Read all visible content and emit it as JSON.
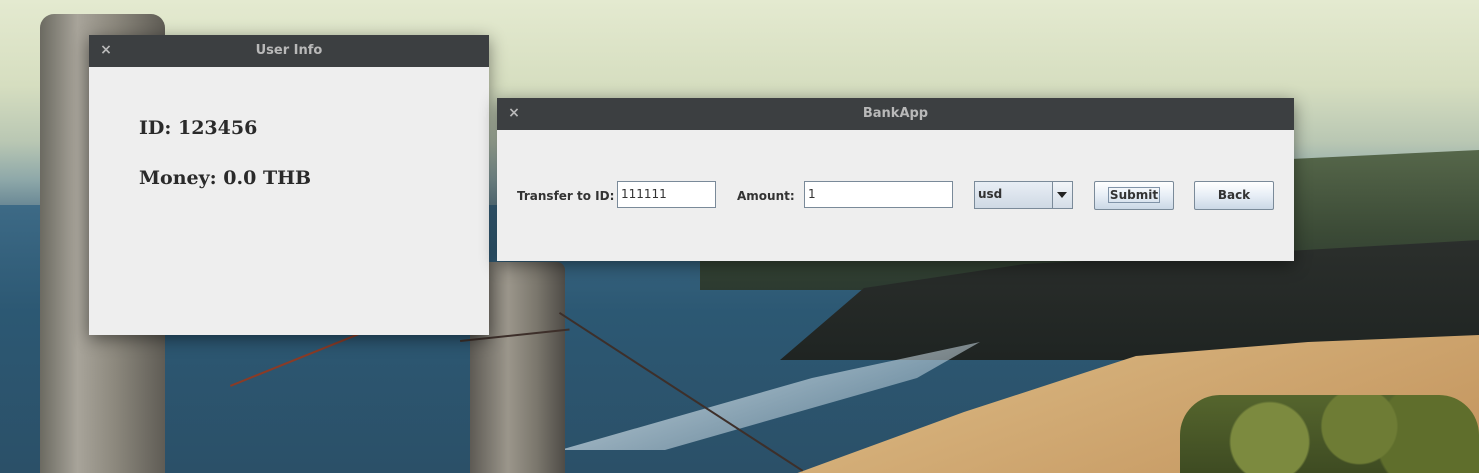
{
  "user_info_window": {
    "title": "User Info",
    "close_glyph": "×",
    "id_line": "ID: 123456",
    "money_line": "Money: 0.0 THB"
  },
  "bankapp_window": {
    "title": "BankApp",
    "close_glyph": "×",
    "transfer_label": "Transfer to ID:",
    "transfer_value": "111111",
    "amount_label": "Amount:",
    "amount_value": "1",
    "currency_selected": "usd",
    "submit_label": "Submit",
    "back_label": "Back"
  },
  "icons": {
    "close": "close-icon",
    "dropdown": "chevron-down-icon"
  },
  "colors": {
    "titlebar": "#3c3f41",
    "window_body": "#eeeeee",
    "title_text": "#b9b9b9"
  }
}
